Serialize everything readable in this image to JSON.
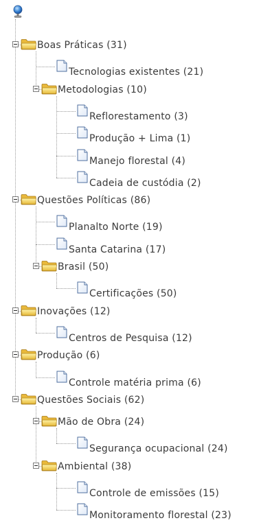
{
  "tree": [
    {
      "label": "Boas Práticas (31)",
      "children": [
        {
          "label": "Tecnologias existentes (21)"
        },
        {
          "label": "Metodologias (10)",
          "children": [
            {
              "label": "Reflorestamento (3)"
            },
            {
              "label": "Produção + Lima (1)"
            },
            {
              "label": "Manejo florestal (4)"
            },
            {
              "label": "Cadeia de custódia (2)"
            }
          ]
        }
      ]
    },
    {
      "label": "Questões Políticas (86)",
      "children": [
        {
          "label": "Planalto Norte (19)"
        },
        {
          "label": "Santa Catarina (17)"
        },
        {
          "label": "Brasil (50)",
          "children": [
            {
              "label": "Certificações (50)"
            }
          ]
        }
      ]
    },
    {
      "label": "Inovações (12)",
      "children": [
        {
          "label": "Centros de Pesquisa (12)"
        }
      ]
    },
    {
      "label": "Produção (6)",
      "children": [
        {
          "label": "Controle matéria prima (6)"
        }
      ]
    },
    {
      "label": "Questões Sociais (62)",
      "children": [
        {
          "label": "Mão de Obra (24)",
          "children": [
            {
              "label": "Segurança ocupacional (24)"
            }
          ]
        },
        {
          "label": "Ambiental (38)",
          "children": [
            {
              "label": "Controle de emissões (15)"
            },
            {
              "label": "Monitoramento florestal (23)"
            }
          ]
        }
      ]
    }
  ]
}
